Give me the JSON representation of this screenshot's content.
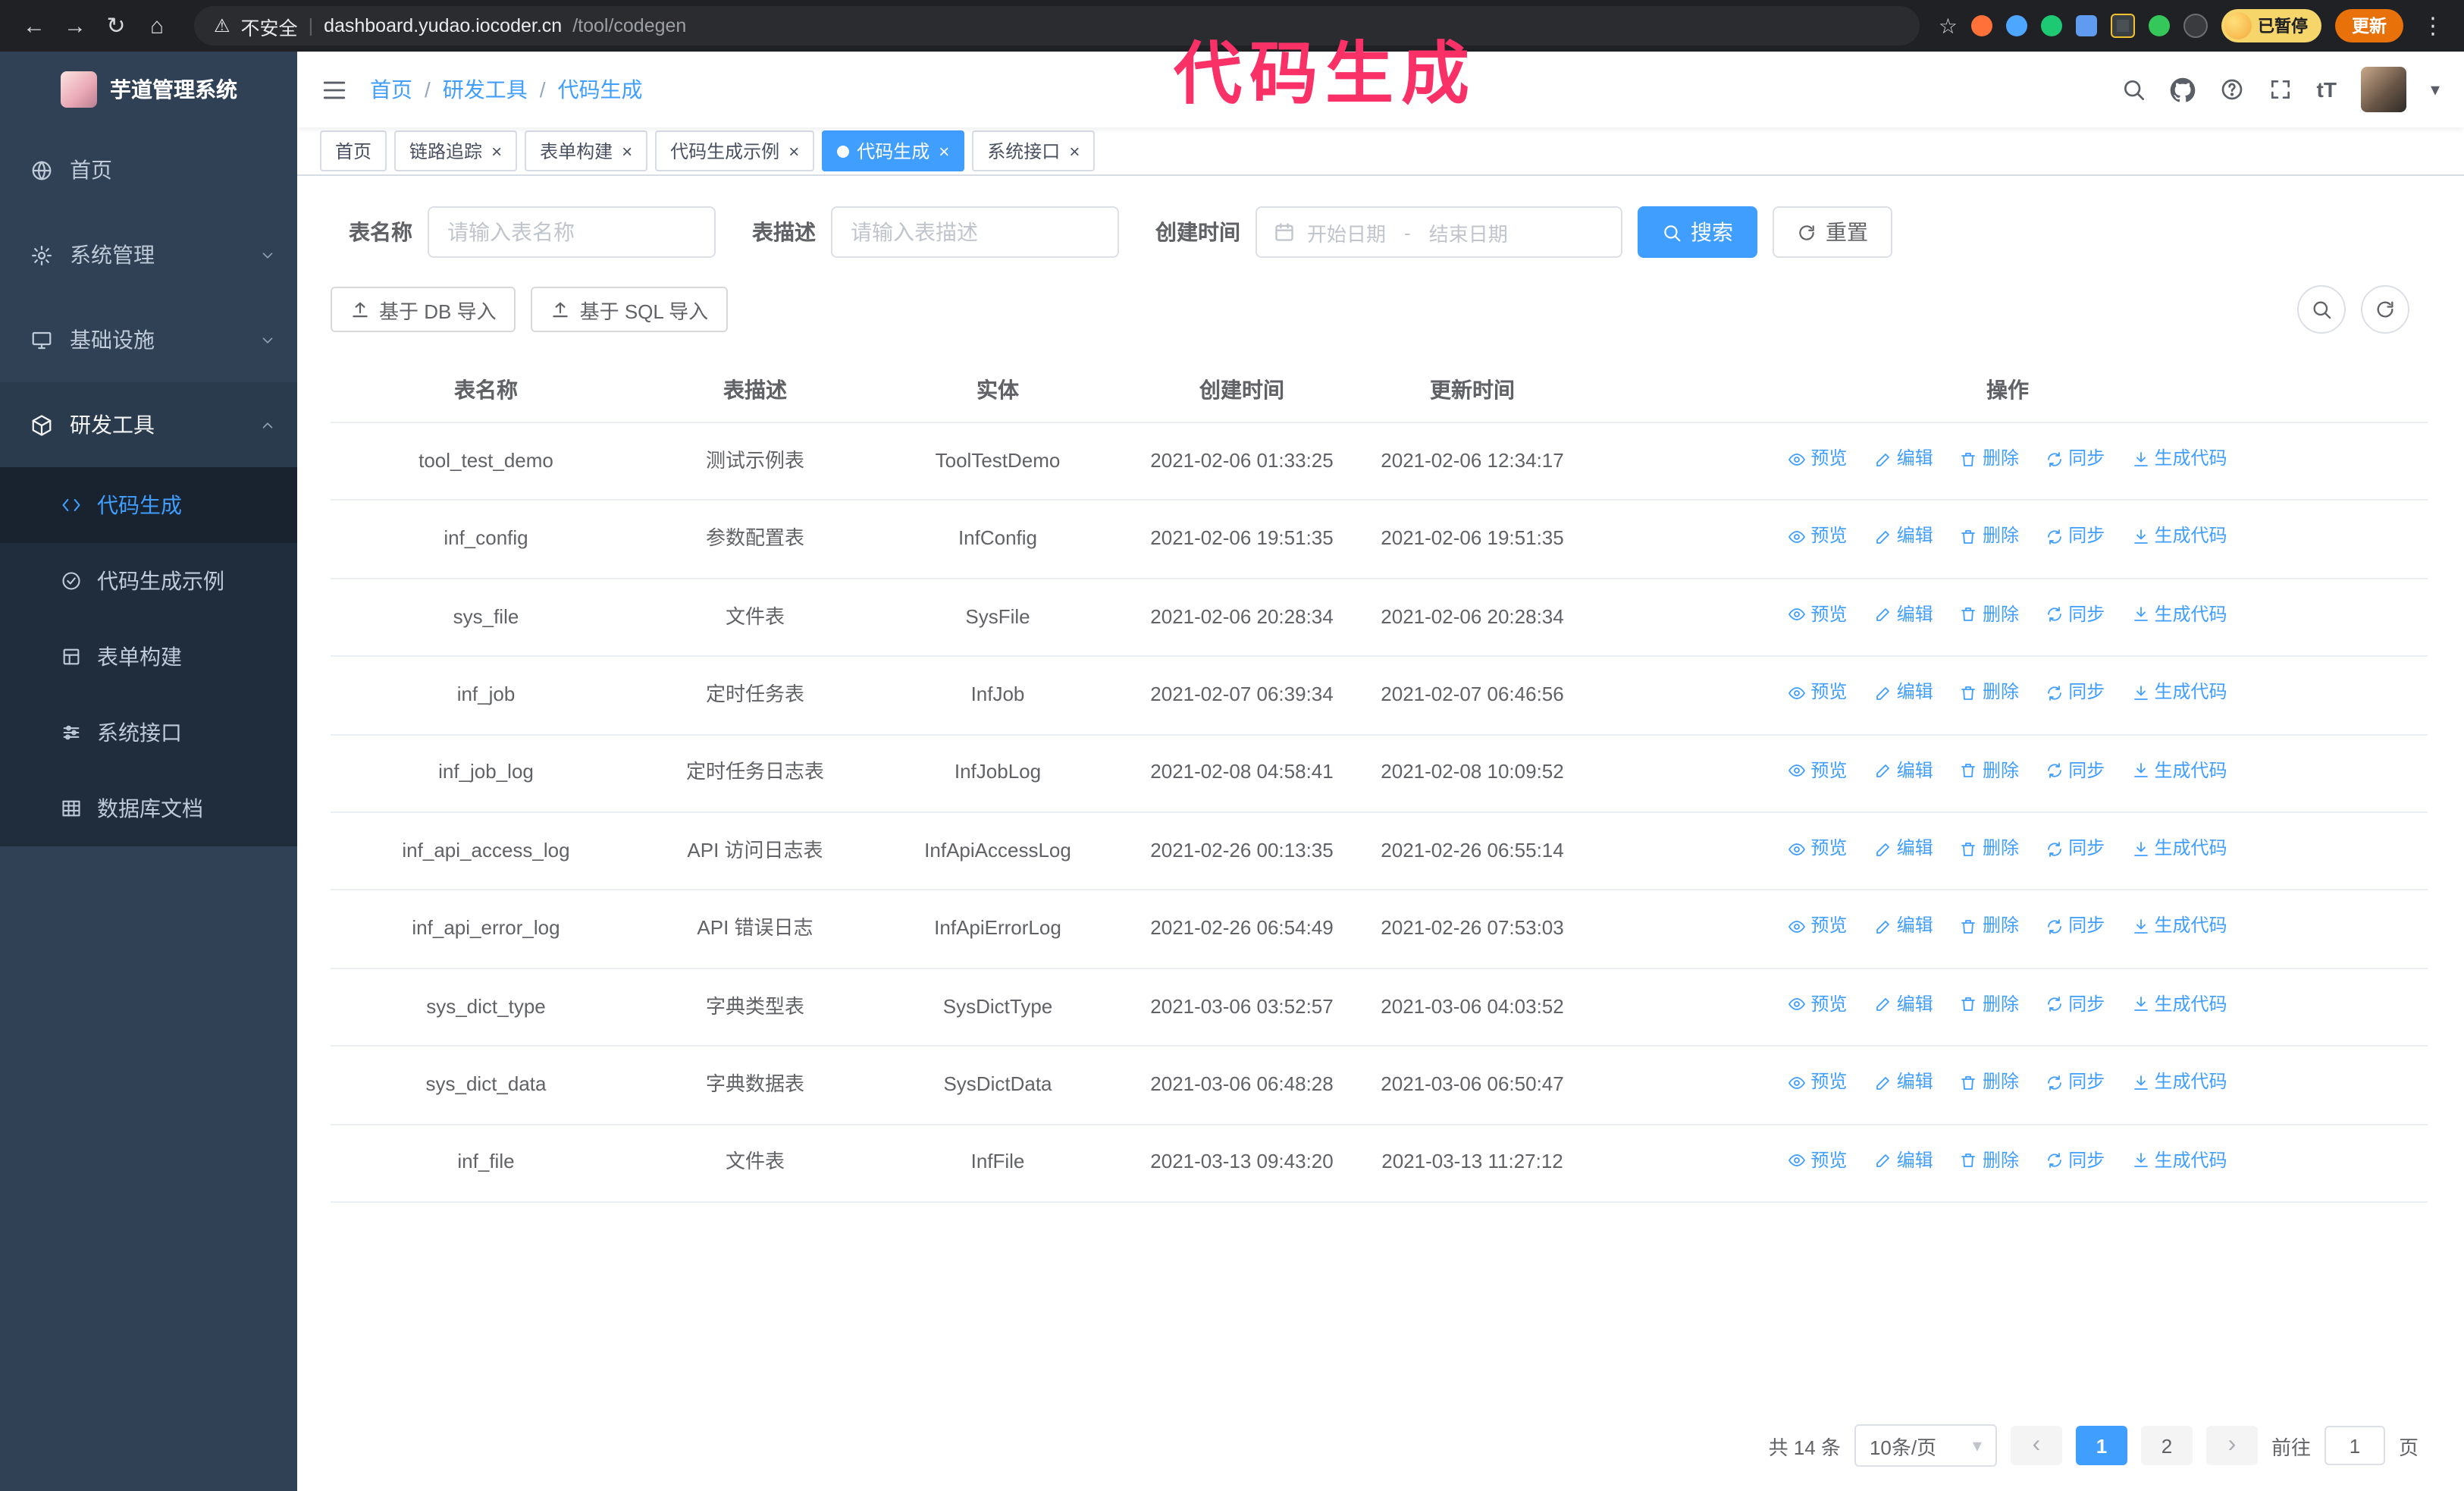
{
  "annotation": {
    "text": "代码生成"
  },
  "colors": {
    "primary": "#409eff",
    "sidebar_bg": "#304156",
    "submenu_bg": "#1f2d3d",
    "annotation": "#fa3166",
    "update_button": "#e8710a",
    "paused_badge": "#f6d56a"
  },
  "glyphs": {
    "back": "←",
    "forward": "→",
    "reload": "↻",
    "home": "⌂",
    "warning": "⚠",
    "divider": "|",
    "star": "☆",
    "overflow": "⋮",
    "caret_down": "▾",
    "close": "×",
    "prev": "‹",
    "next": "›",
    "font_size": "tT"
  },
  "browser": {
    "security_label": "不安全",
    "url_host": "dashboard.yudao.iocoder.cn",
    "url_path": "/tool/codegen",
    "paused_badge": "已暂停",
    "update_button": "更新"
  },
  "sidebar": {
    "logo_title": "芋道管理系统",
    "items": [
      {
        "label": "首页",
        "expandable": false
      },
      {
        "label": "系统管理",
        "expandable": true,
        "expanded": false
      },
      {
        "label": "基础设施",
        "expandable": true,
        "expanded": false
      },
      {
        "label": "研发工具",
        "expandable": true,
        "expanded": true
      }
    ],
    "subitems": [
      {
        "label": "代码生成",
        "active": true
      },
      {
        "label": "代码生成示例",
        "active": false
      },
      {
        "label": "表单构建",
        "active": false
      },
      {
        "label": "系统接口",
        "active": false
      },
      {
        "label": "数据库文档",
        "active": false
      }
    ]
  },
  "header": {
    "breadcrumb": [
      "首页",
      "研发工具",
      "代码生成"
    ],
    "separator": "/"
  },
  "tabs": [
    {
      "label": "首页",
      "closable": false,
      "active": false
    },
    {
      "label": "链路追踪",
      "closable": true,
      "active": false
    },
    {
      "label": "表单构建",
      "closable": true,
      "active": false
    },
    {
      "label": "代码生成示例",
      "closable": true,
      "active": false
    },
    {
      "label": "代码生成",
      "closable": true,
      "active": true
    },
    {
      "label": "系统接口",
      "closable": true,
      "active": false
    }
  ],
  "filters": {
    "table_name_label": "表名称",
    "table_name_placeholder": "请输入表名称",
    "table_desc_label": "表描述",
    "table_desc_placeholder": "请输入表描述",
    "create_time_label": "创建时间",
    "date_start_placeholder": "开始日期",
    "date_separator": "-",
    "date_end_placeholder": "结束日期",
    "search_button": "搜索",
    "reset_button": "重置"
  },
  "toolbar": {
    "import_db": "基于 DB 导入",
    "import_sql": "基于 SQL 导入"
  },
  "table": {
    "columns": [
      "表名称",
      "表描述",
      "实体",
      "创建时间",
      "更新时间",
      "操作"
    ],
    "actions": [
      "预览",
      "编辑",
      "删除",
      "同步",
      "生成代码"
    ],
    "rows": [
      {
        "name": "tool_test_demo",
        "desc": "测试示例表",
        "entity": "ToolTestDemo",
        "created": "2021-02-06 01:33:25",
        "updated": "2021-02-06 12:34:17"
      },
      {
        "name": "inf_config",
        "desc": "参数配置表",
        "entity": "InfConfig",
        "created": "2021-02-06 19:51:35",
        "updated": "2021-02-06 19:51:35"
      },
      {
        "name": "sys_file",
        "desc": "文件表",
        "entity": "SysFile",
        "created": "2021-02-06 20:28:34",
        "updated": "2021-02-06 20:28:34"
      },
      {
        "name": "inf_job",
        "desc": "定时任务表",
        "entity": "InfJob",
        "created": "2021-02-07 06:39:34",
        "updated": "2021-02-07 06:46:56"
      },
      {
        "name": "inf_job_log",
        "desc": "定时任务日志表",
        "entity": "InfJobLog",
        "created": "2021-02-08 04:58:41",
        "updated": "2021-02-08 10:09:52"
      },
      {
        "name": "inf_api_access_log",
        "desc": "API 访问日志表",
        "entity": "InfApiAccessLog",
        "created": "2021-02-26 00:13:35",
        "updated": "2021-02-26 06:55:14"
      },
      {
        "name": "inf_api_error_log",
        "desc": "API 错误日志",
        "entity": "InfApiErrorLog",
        "created": "2021-02-26 06:54:49",
        "updated": "2021-02-26 07:53:03"
      },
      {
        "name": "sys_dict_type",
        "desc": "字典类型表",
        "entity": "SysDictType",
        "created": "2021-03-06 03:52:57",
        "updated": "2021-03-06 04:03:52"
      },
      {
        "name": "sys_dict_data",
        "desc": "字典数据表",
        "entity": "SysDictData",
        "created": "2021-03-06 06:48:28",
        "updated": "2021-03-06 06:50:47"
      },
      {
        "name": "inf_file",
        "desc": "文件表",
        "entity": "InfFile",
        "created": "2021-03-13 09:43:20",
        "updated": "2021-03-13 11:27:12"
      }
    ]
  },
  "pagination": {
    "total": "共 14 条",
    "page_size": "10条/页",
    "pages": [
      "1",
      "2"
    ],
    "active_page": "1",
    "goto_label": "前往",
    "goto_value": "1",
    "goto_suffix": "页"
  }
}
